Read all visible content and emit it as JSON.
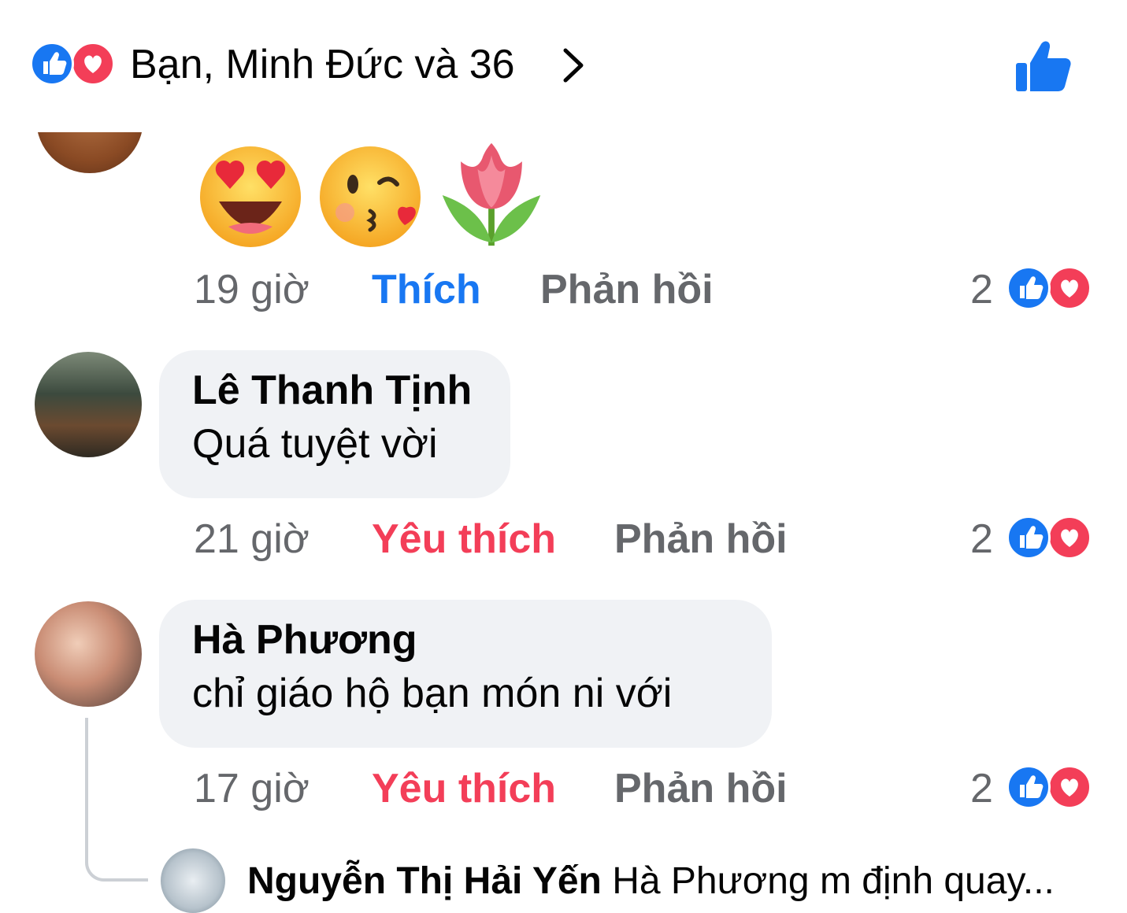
{
  "header": {
    "title": "Bạn, Minh Đức và 36",
    "icons": [
      "like-reaction-icon",
      "love-reaction-icon",
      "chevron-right-icon",
      "thumbs-up-icon"
    ]
  },
  "comments": [
    {
      "author": "",
      "text": "",
      "emojis": [
        "heart-eyes-emoji",
        "kissing-heart-emoji",
        "tulip-emoji"
      ],
      "time": "19 giờ",
      "like_label": "Thích",
      "like_state": "none",
      "reply_label": "Phản hồi",
      "reaction_count": "2"
    },
    {
      "author": "Lê Thanh Tịnh",
      "text": "Quá tuyệt vời",
      "time": "21 giờ",
      "like_label": "Yêu thích",
      "like_state": "love",
      "reply_label": "Phản hồi",
      "reaction_count": "2"
    },
    {
      "author": "Hà Phương",
      "text": "chỉ giáo hộ bạn món ni với",
      "time": "17 giờ",
      "like_label": "Yêu thích",
      "like_state": "love",
      "reply_label": "Phản hồi",
      "reaction_count": "2"
    }
  ],
  "reply_preview": {
    "author": "Nguyễn Thị Hải Yến",
    "text": "Hà Phương m định quay..."
  },
  "colors": {
    "like_blue": "#1877f2",
    "love_red": "#f33e58",
    "secondary_text": "#65676b",
    "bubble_bg": "#f0f2f5"
  }
}
